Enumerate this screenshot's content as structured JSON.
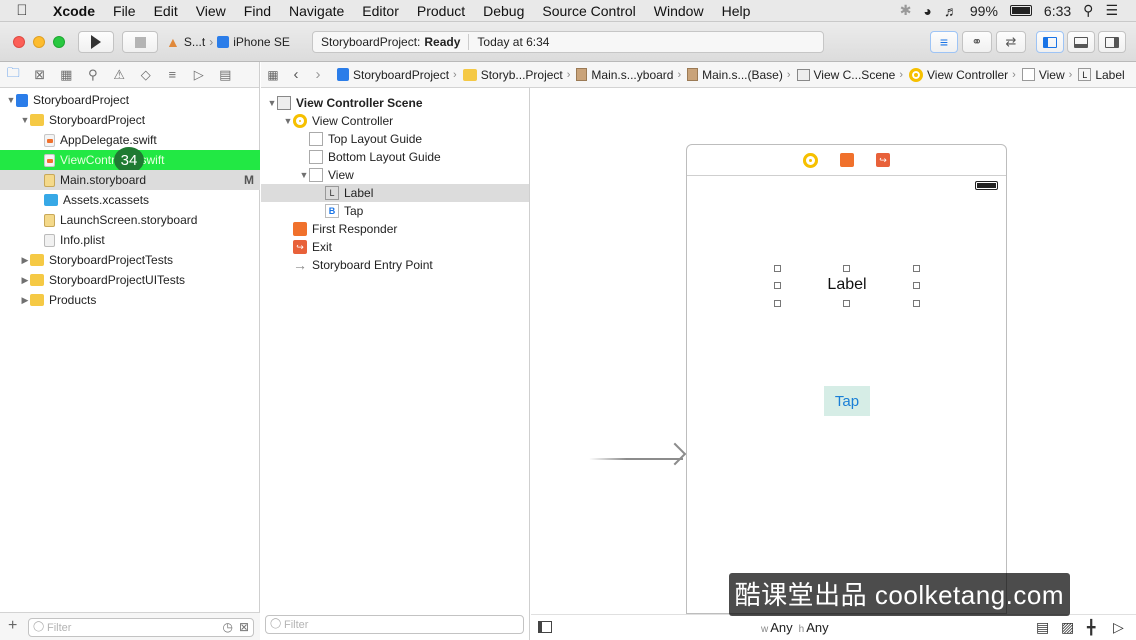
{
  "menubar": {
    "app": "Xcode",
    "items": [
      "File",
      "Edit",
      "View",
      "Find",
      "Navigate",
      "Editor",
      "Product",
      "Debug",
      "Source Control",
      "Window",
      "Help"
    ],
    "battery": "99%",
    "clock": "6:33"
  },
  "toolbar": {
    "scheme": "S...t",
    "device": "iPhone SE",
    "status_project": "StoryboardProject:",
    "status_state": "Ready",
    "status_time": "Today at 6:34"
  },
  "navigator": {
    "items": [
      {
        "label": "StoryboardProject",
        "indent": 0,
        "expanded": true,
        "kind": "project"
      },
      {
        "label": "StoryboardProject",
        "indent": 1,
        "expanded": true,
        "kind": "folder"
      },
      {
        "label": "AppDelegate.swift",
        "indent": 2,
        "kind": "swift"
      },
      {
        "label": "ViewController.swift",
        "indent": 2,
        "kind": "swift",
        "highlight": true
      },
      {
        "label": "Main.storyboard",
        "indent": 2,
        "kind": "storyboard",
        "selected": true,
        "badge": "M"
      },
      {
        "label": "Assets.xcassets",
        "indent": 2,
        "kind": "assets"
      },
      {
        "label": "LaunchScreen.storyboard",
        "indent": 2,
        "kind": "storyboard"
      },
      {
        "label": "Info.plist",
        "indent": 2,
        "kind": "plist"
      },
      {
        "label": "StoryboardProjectTests",
        "indent": 1,
        "expanded": false,
        "kind": "folder"
      },
      {
        "label": "StoryboardProjectUITests",
        "indent": 1,
        "expanded": false,
        "kind": "folder"
      },
      {
        "label": "Products",
        "indent": 1,
        "expanded": false,
        "kind": "folder"
      }
    ],
    "step_badge": "34",
    "filter_placeholder": "Filter"
  },
  "jumpbar": {
    "crumbs": [
      "StoryboardProject",
      "Storyb...Project",
      "Main.s...yboard",
      "Main.s...(Base)",
      "View C...Scene",
      "View Controller",
      "View",
      "Label"
    ]
  },
  "outline": {
    "items": [
      {
        "label": "View Controller Scene",
        "indent": 0,
        "expanded": true,
        "bold": true,
        "icon": "scene"
      },
      {
        "label": "View Controller",
        "indent": 1,
        "expanded": true,
        "icon": "vc"
      },
      {
        "label": "Top Layout Guide",
        "indent": 2,
        "icon": "guide"
      },
      {
        "label": "Bottom Layout Guide",
        "indent": 2,
        "icon": "guide"
      },
      {
        "label": "View",
        "indent": 2,
        "expanded": true,
        "icon": "view"
      },
      {
        "label": "Label",
        "indent": 3,
        "icon": "L",
        "selected": true
      },
      {
        "label": "Tap",
        "indent": 3,
        "icon": "B"
      },
      {
        "label": "First Responder",
        "indent": 1,
        "icon": "responder"
      },
      {
        "label": "Exit",
        "indent": 1,
        "icon": "exit"
      },
      {
        "label": "Storyboard Entry Point",
        "indent": 1,
        "icon": "entry"
      }
    ],
    "filter_placeholder": "Filter"
  },
  "canvas": {
    "label_text": "Label",
    "button_text": "Tap",
    "size_w": "Any",
    "size_h": "Any",
    "size_w_prefix": "w",
    "size_h_prefix": "h"
  },
  "watermark": "酷课堂出品 coolketang.com",
  "colors": {
    "accent": "#1a74e6",
    "highlight_green": "#22e844",
    "selection_gray": "#dcdcdc",
    "button_bg": "#d6ede6",
    "button_text": "#1a7fd6"
  }
}
